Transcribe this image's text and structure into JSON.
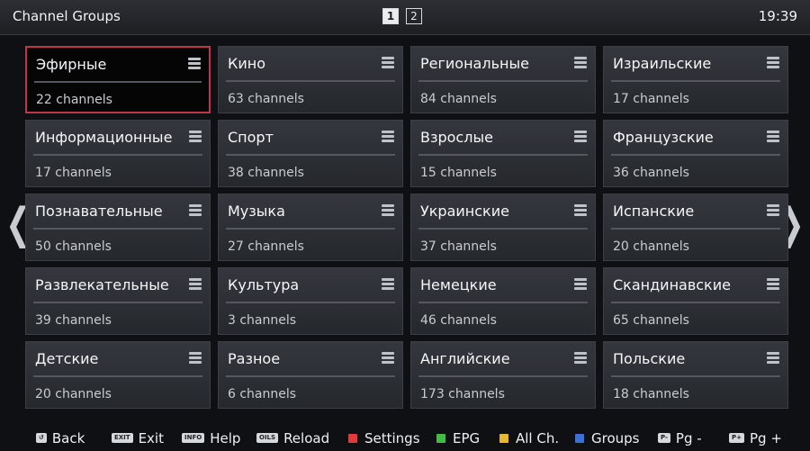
{
  "header": {
    "title": "Channel Groups",
    "pages": [
      "1",
      "2"
    ],
    "active_page": "1",
    "time": "19:39"
  },
  "nav": {
    "left_arrow": "❮",
    "right_arrow": "❯"
  },
  "groups": [
    {
      "name": "Эфирные",
      "count": "22 channels"
    },
    {
      "name": "Кино",
      "count": "63 channels"
    },
    {
      "name": "Региональные",
      "count": "84 channels"
    },
    {
      "name": "Израильские",
      "count": "17 channels"
    },
    {
      "name": "Информационные",
      "count": "17 channels"
    },
    {
      "name": "Спорт",
      "count": "38 channels"
    },
    {
      "name": "Взрослые",
      "count": "15 channels"
    },
    {
      "name": "Французские",
      "count": "36 channels"
    },
    {
      "name": "Познавательные",
      "count": "50 channels"
    },
    {
      "name": "Музыка",
      "count": "27 channels"
    },
    {
      "name": "Украинские",
      "count": "37 channels"
    },
    {
      "name": "Испанские",
      "count": "20 channels"
    },
    {
      "name": "Развлекательные",
      "count": "39 channels"
    },
    {
      "name": "Культура",
      "count": "3 channels"
    },
    {
      "name": "Немецкие",
      "count": "46 channels"
    },
    {
      "name": "Скандинавские",
      "count": "65 channels"
    },
    {
      "name": "Детские",
      "count": "20 channels"
    },
    {
      "name": "Разное",
      "count": "6 channels"
    },
    {
      "name": "Английские",
      "count": "173 channels"
    },
    {
      "name": "Польские",
      "count": "18 channels"
    }
  ],
  "footer": {
    "back": {
      "key": "↺",
      "label": "Back"
    },
    "exit": {
      "key": "EXIT",
      "label": "Exit"
    },
    "help": {
      "key": "INFO",
      "label": "Help"
    },
    "reload": {
      "key": "OILS",
      "label": "Reload"
    },
    "settings": {
      "color": "#e23a3a",
      "label": "Settings"
    },
    "epg": {
      "color": "#3fbf3f",
      "label": "EPG"
    },
    "allch": {
      "color": "#e8b92a",
      "label": "All Ch."
    },
    "groups": {
      "color": "#3a6fe0",
      "label": "Groups"
    },
    "pgminus": {
      "key": "P-",
      "label": "Pg -"
    },
    "pgplus": {
      "key": "P+",
      "label": "Pg +"
    }
  },
  "colors": {
    "selection_border": "#c0364a"
  }
}
